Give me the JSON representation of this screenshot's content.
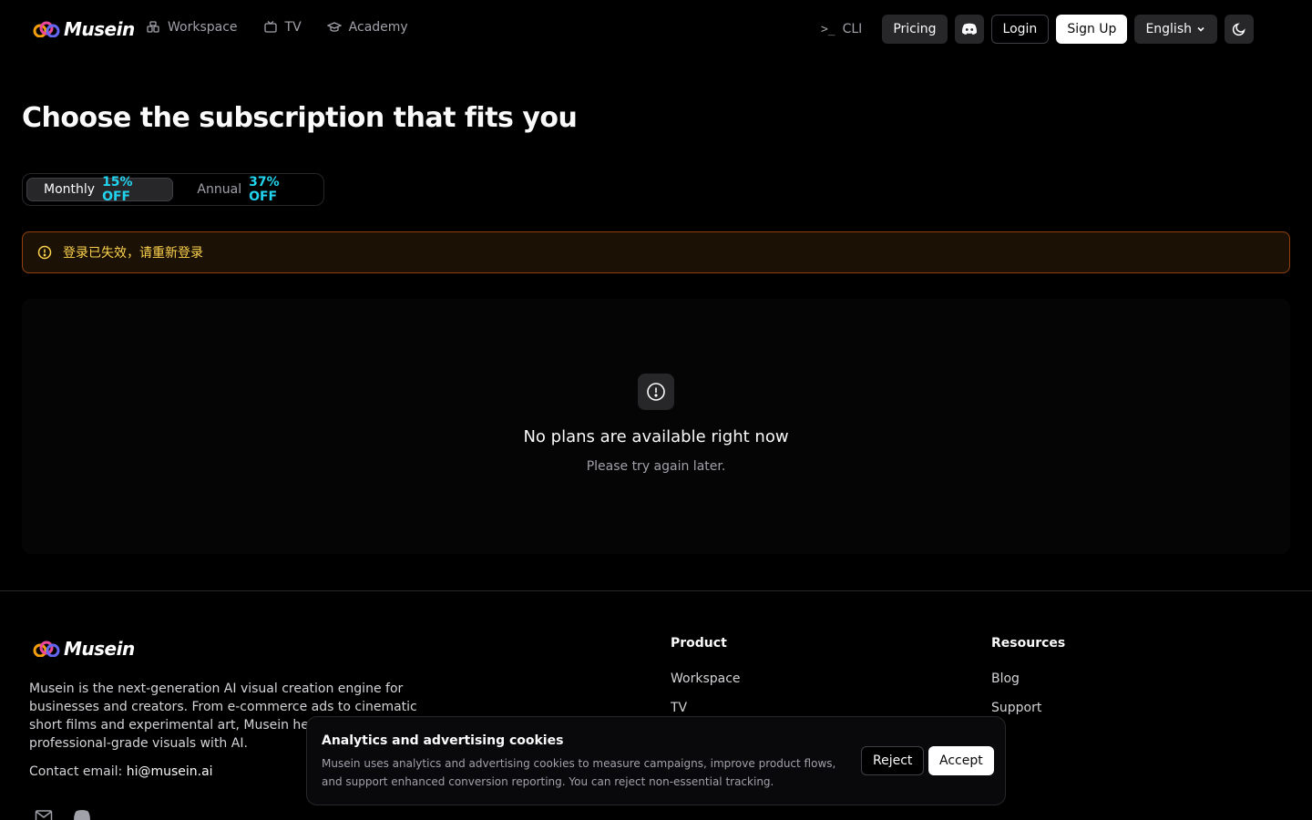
{
  "brand": {
    "name": "Musein"
  },
  "nav": [
    {
      "label": "Workspace",
      "icon": "workspace-icon"
    },
    {
      "label": "TV",
      "icon": "tv-icon"
    },
    {
      "label": "Academy",
      "icon": "graduation-cap-icon"
    }
  ],
  "header_right": {
    "cli_label": "CLI",
    "pricing_label": "Pricing",
    "login_label": "Login",
    "signup_label": "Sign Up",
    "language_label": "English"
  },
  "page": {
    "title": "Choose the subscription that fits you"
  },
  "billing_toggle": {
    "monthly_label": "Monthly",
    "monthly_discount": "15% OFF",
    "annual_label": "Annual",
    "annual_discount": "37% OFF",
    "selected": "monthly"
  },
  "alert": {
    "message": "登录已失效，请重新登录"
  },
  "empty_state": {
    "title": "No plans are available right now",
    "subtitle": "Please try again later."
  },
  "footer": {
    "description": "Musein is the next-generation AI visual creation engine for businesses and creators. From e-commerce ads to cinematic short films and experimental art, Musein helps anyone create professional-grade visuals with AI.",
    "contact_label": "Contact email:",
    "contact_email": "hi@musein.ai",
    "product": {
      "title": "Product",
      "links": [
        "Workspace",
        "TV"
      ]
    },
    "resources": {
      "title": "Resources",
      "links": [
        "Blog",
        "Support"
      ]
    }
  },
  "cookie_banner": {
    "title": "Analytics and advertising cookies",
    "text": "Musein uses analytics and advertising cookies to measure campaigns, improve product flows, and support enhanced conversion reporting. You can reject non-essential tracking.",
    "reject_label": "Reject",
    "accept_label": "Accept"
  },
  "colors": {
    "accent_discount": "#22d3ee",
    "alert_text": "#fcd34d",
    "alert_border": "#92400e"
  }
}
